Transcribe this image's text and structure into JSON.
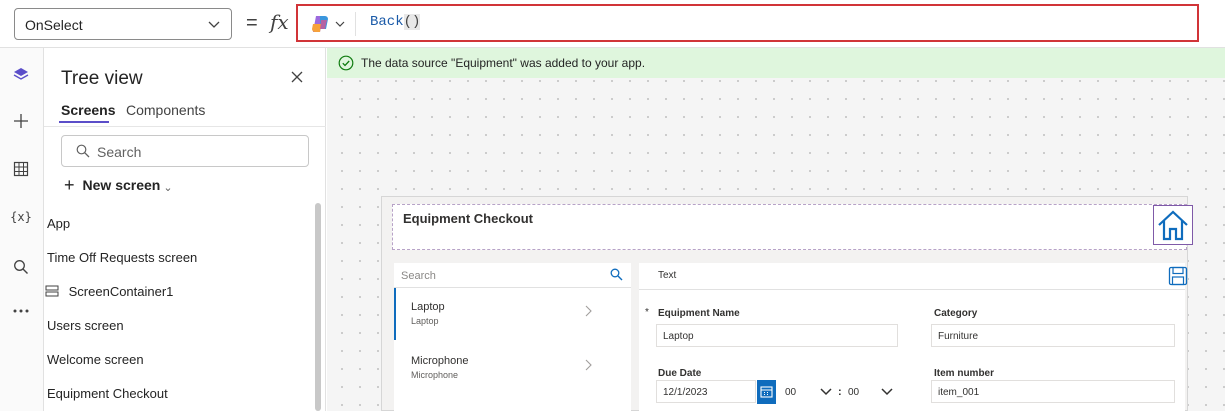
{
  "formula_bar": {
    "property": "OnSelect",
    "equals": "=",
    "fx": "fx",
    "formula_func": "Back",
    "formula_parens": "()"
  },
  "tree_view": {
    "title": "Tree view",
    "tabs": [
      "Screens",
      "Components"
    ],
    "search_placeholder": "Search",
    "new_screen": "New screen",
    "items": [
      "App",
      "Time Off Requests screen",
      "ScreenContainer1",
      "Users screen",
      "Welcome screen",
      "Equipment Checkout"
    ]
  },
  "notification": {
    "message": "The data source \"Equipment\" was added to your app."
  },
  "app": {
    "title": "Equipment Checkout",
    "gallery": {
      "search_placeholder": "Search",
      "rows": [
        {
          "title": "Laptop",
          "subtitle": "Laptop"
        },
        {
          "title": "Microphone",
          "subtitle": "Microphone"
        }
      ]
    },
    "form": {
      "header": "Text",
      "fields": {
        "equipment_name_label": "Equipment Name",
        "equipment_name_value": "Laptop",
        "category_label": "Category",
        "category_value": "Furniture",
        "due_date_label": "Due Date",
        "due_date_value": "12/1/2023",
        "hour_value": "00",
        "minute_value": "00",
        "time_sep": ":",
        "item_number_label": "Item number",
        "item_number_value": "item_001",
        "required_mark": "*"
      }
    }
  },
  "colors": {
    "accent": "#5b4ec9",
    "error_border": "#d13438",
    "success_bg": "#dff6dd",
    "brand_blue": "#0f6cbd"
  }
}
